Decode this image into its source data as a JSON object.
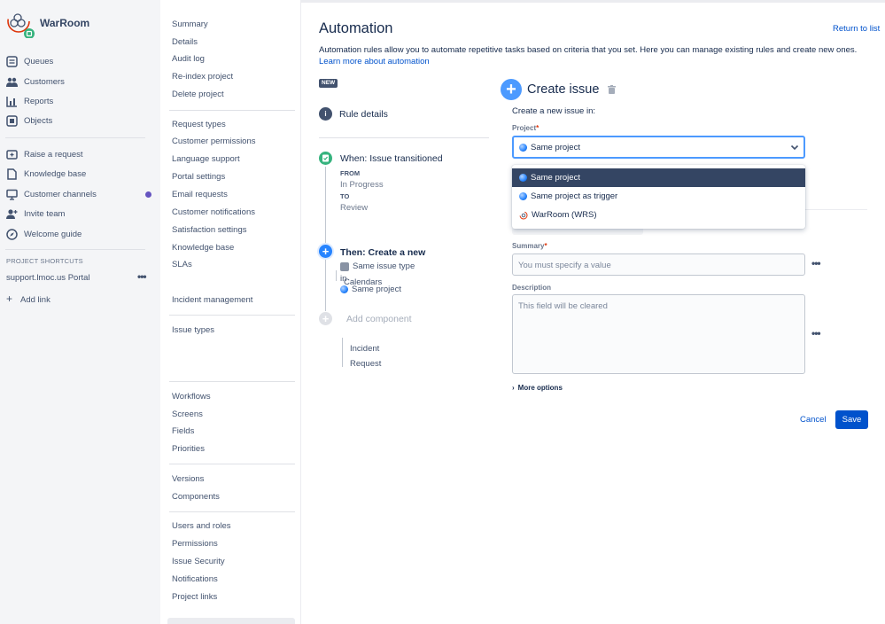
{
  "app": {
    "name": "WarRoom"
  },
  "nav": {
    "items": [
      {
        "label": "Queues",
        "icon": "queue-icon"
      },
      {
        "label": "Customers",
        "icon": "customers-icon"
      },
      {
        "label": "Reports",
        "icon": "reports-icon"
      },
      {
        "label": "Objects",
        "icon": "objects-icon"
      },
      {
        "label": "Raise a request",
        "icon": "raise-request-icon"
      },
      {
        "label": "Knowledge base",
        "icon": "knowledge-base-icon"
      },
      {
        "label": "Customer channels",
        "icon": "monitor-icon"
      },
      {
        "label": "Invite team",
        "icon": "invite-icon"
      },
      {
        "label": "Welcome guide",
        "icon": "compass-icon"
      }
    ],
    "shortcuts_heading": "PROJECT SHORTCUTS",
    "shortcut": "support.lmoc.us Portal",
    "add_link": "Add link"
  },
  "settings": {
    "summary": "Summary",
    "details": "Details",
    "audit_log": "Audit log",
    "reindex": "Re-index project",
    "delete": "Delete project",
    "request_types": "Request types",
    "customer_permissions": "Customer permissions",
    "language_support": "Language support",
    "portal_settings": "Portal settings",
    "email_requests": "Email requests",
    "customer_notifications": "Customer notifications",
    "satisfaction_settings": "Satisfaction settings",
    "knowledge_base": "Knowledge base",
    "slas": "SLAs",
    "calendars": "Calendars",
    "incident_management": "Incident management",
    "issue_types": "Issue types",
    "incident": "Incident",
    "request": "Request",
    "workflows": "Workflows",
    "screens": "Screens",
    "fields": "Fields",
    "priorities": "Priorities",
    "versions": "Versions",
    "components": "Components",
    "users_roles": "Users and roles",
    "permissions": "Permissions",
    "issue_security": "Issue Security",
    "notifications": "Notifications",
    "project_links": "Project links"
  },
  "main": {
    "title": "Automation",
    "return": "Return to list",
    "description": "Automation rules allow you to automate repetitive tasks based on criteria that you set. Here you can manage existing rules and create new ones. ",
    "learn_more": "Learn more about automation",
    "new_badge": "NEW",
    "rule_details": "Rule details",
    "when": {
      "title": "When: Issue transitioned",
      "from_label": "FROM",
      "from": "In Progress",
      "to_label": "TO",
      "to": "Review"
    },
    "then": {
      "title": "Then: Create a new",
      "issue_type": "Same issue type",
      "in": "in",
      "project": "Same project"
    },
    "add_component": "Add component"
  },
  "form": {
    "title": "Create issue",
    "subtitle": "Create a new issue in:",
    "project_label": "Project",
    "project_value": "Same project",
    "options": [
      "Same project",
      "Same project as trigger",
      "WarRoom (WRS)"
    ],
    "summary_label": "Summary",
    "summary_placeholder": "You must specify a value",
    "description_label": "Description",
    "description_placeholder": "This field will be cleared",
    "more_options": "More options",
    "cancel": "Cancel",
    "save": "Save"
  },
  "colors": {
    "accent": "#0052cc",
    "selected_option": "#344563",
    "when_icon": "#36b37e",
    "then_icon": "#2684ff",
    "badge": "#6554c0"
  }
}
